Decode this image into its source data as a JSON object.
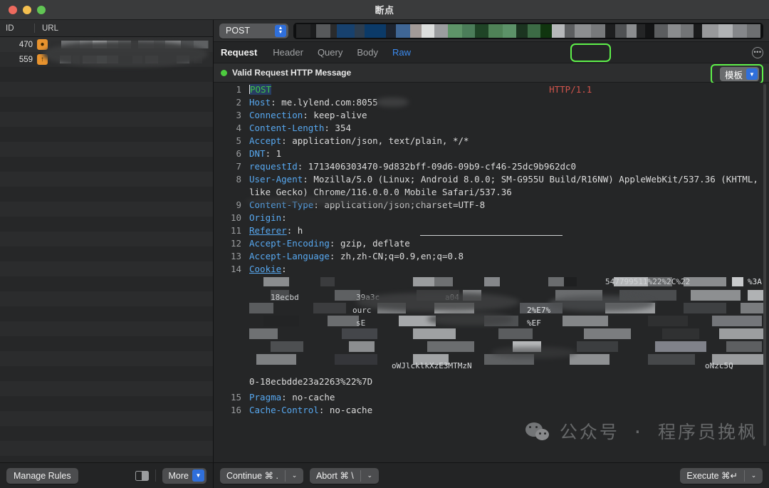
{
  "window": {
    "title": "断点",
    "traffic_lights": [
      "close",
      "minimize",
      "zoom"
    ]
  },
  "sidebar": {
    "columns": {
      "id": "ID",
      "url": "URL"
    },
    "rows": [
      {
        "id": "470",
        "icon": "orange-circle-icon",
        "url": "[redacted]"
      },
      {
        "id": "559",
        "icon": "orange-arrow-up-icon",
        "url": "[redacted]"
      }
    ]
  },
  "urlbar": {
    "method": "POST",
    "method_stepper_icon": "stepper-updown-icon",
    "url_value": "[redacted]"
  },
  "tabs": {
    "section_title": "Request",
    "items": [
      {
        "label": "Header",
        "active": false
      },
      {
        "label": "Query",
        "active": false
      },
      {
        "label": "Body",
        "active": false
      },
      {
        "label": "Raw",
        "active": true
      }
    ],
    "overflow_icon": "ellipsis-circle-icon"
  },
  "status": {
    "dot_color": "#4dcc3f",
    "text": "Valid Request HTTP Message",
    "template_button": "模板",
    "template_chevron_icon": "chevron-down-icon",
    "highlight_color": "#5ef04a"
  },
  "code": {
    "lines": [
      {
        "n": "1",
        "type": "request-line",
        "method": "POST",
        "target": "[redacted]",
        "proto": "HTTP/1.1"
      },
      {
        "n": "2",
        "type": "header",
        "key": "Host",
        "value": "me.lylend.com:8055"
      },
      {
        "n": "3",
        "type": "header",
        "key": "Connection",
        "value": "keep-alive"
      },
      {
        "n": "4",
        "type": "header",
        "key": "Content-Length",
        "value": "354"
      },
      {
        "n": "5",
        "type": "header",
        "key": "Accept",
        "value": "application/json, text/plain, */*"
      },
      {
        "n": "6",
        "type": "header",
        "key": "DNT",
        "value": "1"
      },
      {
        "n": "7",
        "type": "header",
        "key": "requestId",
        "value": "1713406303470-9d832bff-09d6-09b9-cf46-25dc9b962dc0"
      },
      {
        "n": "8",
        "type": "header",
        "key": "User-Agent",
        "value": "Mozilla/5.0 (Linux; Android 8.0.0; SM-G955U Build/R16NW) AppleWebKit/537.36 (KHTML, like Gecko) Chrome/116.0.0.0 Mobile Safari/537.36"
      },
      {
        "n": "9",
        "type": "header",
        "key": "Content-Type",
        "value": "application/json;charset=UTF-8"
      },
      {
        "n": "10",
        "type": "header-redacted",
        "key": "Origin",
        "value": "[redacted]"
      },
      {
        "n": "11",
        "type": "header-redacted",
        "key": "Referer",
        "value": "h[redacted]"
      },
      {
        "n": "12",
        "type": "header",
        "key": "Accept-Encoding",
        "value": "gzip, deflate"
      },
      {
        "n": "13",
        "type": "header",
        "key": "Accept-Language",
        "value": "zh,zh-CN;q=0.9,en;q=0.8"
      },
      {
        "n": "14",
        "type": "header-redacted-block",
        "key": "Cookie",
        "value": "[redacted]",
        "tail": "0-18ecbdde23a2263%22%7D",
        "edge_right": "%3A"
      },
      {
        "n": "15",
        "type": "header",
        "key": "Pragma",
        "value": "no-cache"
      },
      {
        "n": "16",
        "type": "header",
        "key": "Cache-Control",
        "value": "no-cache"
      }
    ]
  },
  "watermark": {
    "icon": "wechat-icon",
    "text": "公众号 · 程序员挽枫"
  },
  "bottombar": {
    "manage_rules": "Manage Rules",
    "panel_toggle_icon": "sidebar-panel-icon",
    "more_label": "More",
    "more_chevron_icon": "chevron-down-icon",
    "continue_label": "Continue ⌘ .",
    "continue_chevron_icon": "chevron-down-icon",
    "abort_label": "Abort ⌘ \\",
    "abort_chevron_icon": "chevron-down-icon",
    "execute_label": "Execute ⌘↵",
    "execute_chevron_icon": "chevron-down-icon"
  },
  "colors": {
    "accent_blue": "#2f6fdb",
    "highlight_green": "#5ef04a",
    "status_green": "#4dcc3f",
    "header_key_blue": "#57a8f0",
    "method_green": "#3fc24a",
    "proto_red": "#d1544c",
    "row_icon_orange": "#e8932e"
  }
}
